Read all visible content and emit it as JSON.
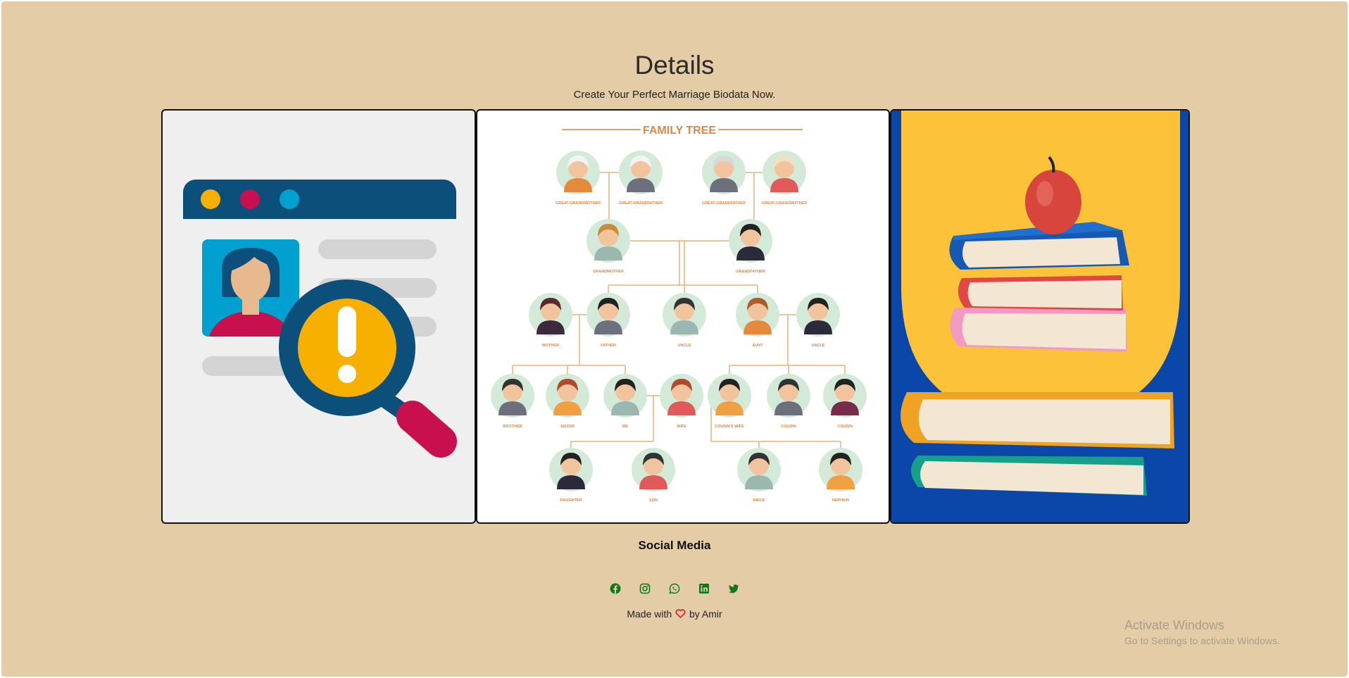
{
  "header": {
    "title": "Details",
    "subtitle": "Create Your Perfect Marriage Biodata Now."
  },
  "cards": [
    {
      "illustration": "profile-search-warning"
    },
    {
      "illustration": "family-tree",
      "heading": "FAMILY TREE",
      "labels": [
        "GREAT-GRANDMOTHER",
        "GREAT-GRANDFATHER",
        "GREAT-GRANDFATHER",
        "GREAT-GRANDMOTHER",
        "GRANDMOTHER",
        "GRANDFATHER",
        "MOTHER",
        "FATHER",
        "UNCLE",
        "AUNT",
        "UNCLE",
        "BROTHER",
        "SISTER",
        "ME",
        "WIFE",
        "COUSIN'S WIFE",
        "COUSIN",
        "COUSIN",
        "DAUGHTER",
        "SON",
        "NIECE",
        "NEPHEW"
      ]
    },
    {
      "illustration": "book-stack-apple"
    }
  ],
  "social": {
    "title": "Social Media",
    "icons": [
      "facebook-icon",
      "instagram-icon",
      "whatsapp-icon",
      "linkedin-icon",
      "twitter-icon"
    ],
    "icon_color": "#0a7a1a"
  },
  "footer": {
    "made_with": "Made with",
    "by": "by Amir",
    "heart_color": "#e0241c"
  },
  "watermark": {
    "line1": "Activate Windows",
    "line2": "Go to Settings to activate Windows."
  },
  "colors": {
    "background": "#e4cca6",
    "accent_yellow": "#f8b000",
    "accent_navy": "#0b4f7a",
    "accent_magenta": "#c8104f"
  }
}
